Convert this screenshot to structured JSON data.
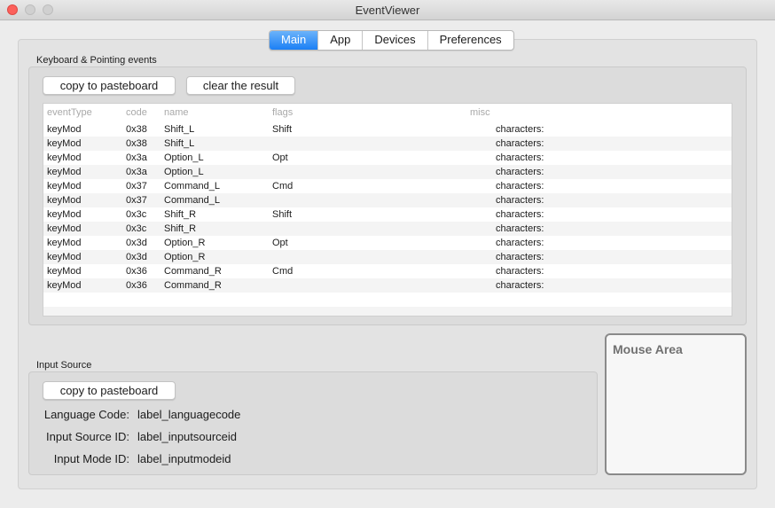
{
  "window": {
    "title": "EventViewer"
  },
  "tabs": [
    {
      "label": "Main",
      "active": true
    },
    {
      "label": "App",
      "active": false
    },
    {
      "label": "Devices",
      "active": false
    },
    {
      "label": "Preferences",
      "active": false
    }
  ],
  "keyboard": {
    "group_label": "Keyboard & Pointing events",
    "copy_button": "copy to pasteboard",
    "clear_button": "clear the result",
    "columns": [
      "eventType",
      "code",
      "name",
      "flags",
      "misc"
    ],
    "rows": [
      {
        "eventType": "keyMod",
        "code": "0x38",
        "name": "Shift_L",
        "flags": "Shift",
        "misc": "characters:"
      },
      {
        "eventType": "keyMod",
        "code": "0x38",
        "name": "Shift_L",
        "flags": "",
        "misc": "characters:"
      },
      {
        "eventType": "keyMod",
        "code": "0x3a",
        "name": "Option_L",
        "flags": "Opt",
        "misc": "characters:"
      },
      {
        "eventType": "keyMod",
        "code": "0x3a",
        "name": "Option_L",
        "flags": "",
        "misc": "characters:"
      },
      {
        "eventType": "keyMod",
        "code": "0x37",
        "name": "Command_L",
        "flags": "Cmd",
        "misc": "characters:"
      },
      {
        "eventType": "keyMod",
        "code": "0x37",
        "name": "Command_L",
        "flags": "",
        "misc": "characters:"
      },
      {
        "eventType": "keyMod",
        "code": "0x3c",
        "name": "Shift_R",
        "flags": "Shift",
        "misc": "characters:"
      },
      {
        "eventType": "keyMod",
        "code": "0x3c",
        "name": "Shift_R",
        "flags": "",
        "misc": "characters:"
      },
      {
        "eventType": "keyMod",
        "code": "0x3d",
        "name": "Option_R",
        "flags": "Opt",
        "misc": "characters:"
      },
      {
        "eventType": "keyMod",
        "code": "0x3d",
        "name": "Option_R",
        "flags": "",
        "misc": "characters:"
      },
      {
        "eventType": "keyMod",
        "code": "0x36",
        "name": "Command_R",
        "flags": "Cmd",
        "misc": "characters:"
      },
      {
        "eventType": "keyMod",
        "code": "0x36",
        "name": "Command_R",
        "flags": "",
        "misc": "characters:"
      },
      {
        "eventType": "",
        "code": "",
        "name": "",
        "flags": "",
        "misc": ""
      },
      {
        "eventType": "",
        "code": "",
        "name": "",
        "flags": "",
        "misc": ""
      }
    ]
  },
  "input_source": {
    "group_label": "Input Source",
    "copy_button": "copy to pasteboard",
    "language_code_label": "Language Code:",
    "language_code_value": "label_languagecode",
    "input_source_id_label": "Input Source ID:",
    "input_source_id_value": "label_inputsourceid",
    "input_mode_id_label": "Input Mode ID:",
    "input_mode_id_value": "label_inputmodeid"
  },
  "mouse_area": {
    "label": "Mouse Area"
  },
  "colors": {
    "accent": "#1b7ff5",
    "close": "#fc605b"
  }
}
